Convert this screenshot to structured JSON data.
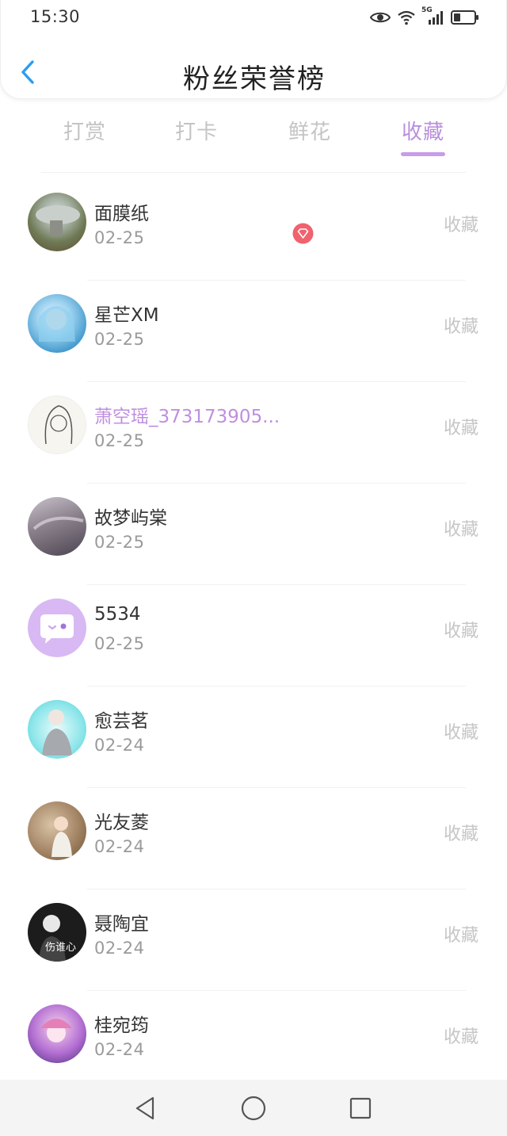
{
  "status_bar": {
    "time": "15:30",
    "network_label": "5G",
    "icons": [
      "eye-icon",
      "wifi-icon",
      "signal-icon",
      "battery-icon"
    ]
  },
  "header": {
    "title": "粉丝荣誉榜",
    "back_icon": "chevron-left-icon"
  },
  "tabs": [
    {
      "label": "打赏",
      "active": false
    },
    {
      "label": "打卡",
      "active": false
    },
    {
      "label": "鲜花",
      "active": false
    },
    {
      "label": "收藏",
      "active": true
    }
  ],
  "colors": {
    "accent": "#b98fdc",
    "back_arrow": "#2a9df4",
    "vip_badge": "#f0626e"
  },
  "fans": [
    {
      "name": "面膜纸",
      "date": "02-25",
      "action": "收藏",
      "vip": false
    },
    {
      "name": "星芒XM",
      "date": "02-25",
      "action": "收藏",
      "vip": false
    },
    {
      "name": "萧空瑶_373173905...",
      "date": "02-25",
      "action": "收藏",
      "vip": true
    },
    {
      "name": "故梦屿棠",
      "date": "02-25",
      "action": "收藏",
      "vip": false
    },
    {
      "name": "5534",
      "date": "02-25",
      "action": "收藏",
      "vip": false
    },
    {
      "name": "愈芸茗",
      "date": "02-24",
      "action": "收藏",
      "vip": false
    },
    {
      "name": "光友菱",
      "date": "02-24",
      "action": "收藏",
      "vip": false
    },
    {
      "name": "聂陶宜",
      "date": "02-24",
      "action": "收藏",
      "vip": false
    },
    {
      "name": "桂宛筠",
      "date": "02-24",
      "action": "收藏",
      "vip": false
    }
  ],
  "avatar_text": {
    "row8": "伤谁心"
  },
  "system_nav": [
    "back-triangle-icon",
    "home-circle-icon",
    "recents-square-icon"
  ]
}
